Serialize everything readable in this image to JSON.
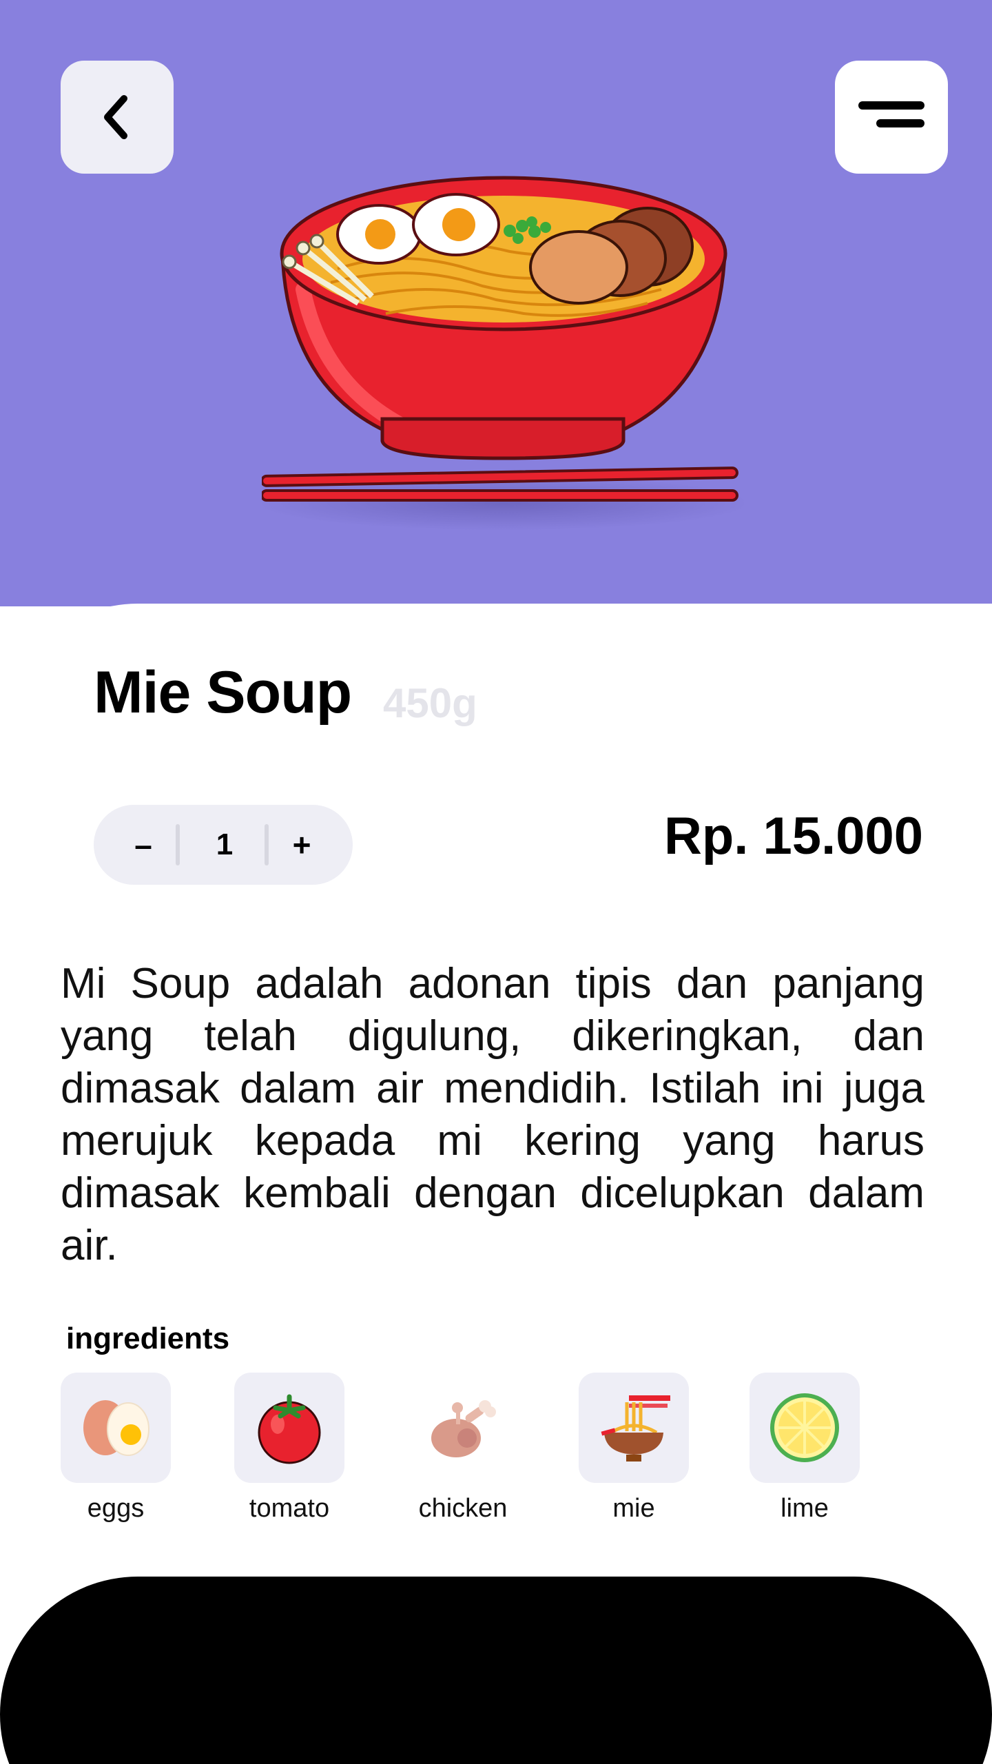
{
  "header": {
    "back_icon": "chevron-left-icon",
    "menu_icon": "menu-lines-icon"
  },
  "product": {
    "name": "Mie Soup",
    "weight": "450g",
    "quantity": "1",
    "minus_label": "–",
    "plus_label": "+",
    "price": "Rp. 15.000",
    "description": "Mi Soup adalah adonan tipis dan panjang yang telah digulung, dikeringkan, dan dimasak dalam air mendidih. Istilah ini juga merujuk kepada mi kering yang harus dimasak kembali dengan dicelupkan dalam air."
  },
  "ingredients": {
    "title": "ingredients",
    "items": [
      {
        "label": "eggs",
        "icon": "eggs-icon"
      },
      {
        "label": "tomato",
        "icon": "tomato-icon"
      },
      {
        "label": "chicken",
        "icon": "chicken-icon"
      },
      {
        "label": "mie",
        "icon": "noodles-icon"
      },
      {
        "label": "lime",
        "icon": "lime-icon"
      }
    ]
  },
  "colors": {
    "hero_bg": "#8880DE",
    "tile_bg": "#EEEEF6",
    "bowl_red": "#E8222E",
    "text": "#000000",
    "muted": "#E4E4EA"
  }
}
